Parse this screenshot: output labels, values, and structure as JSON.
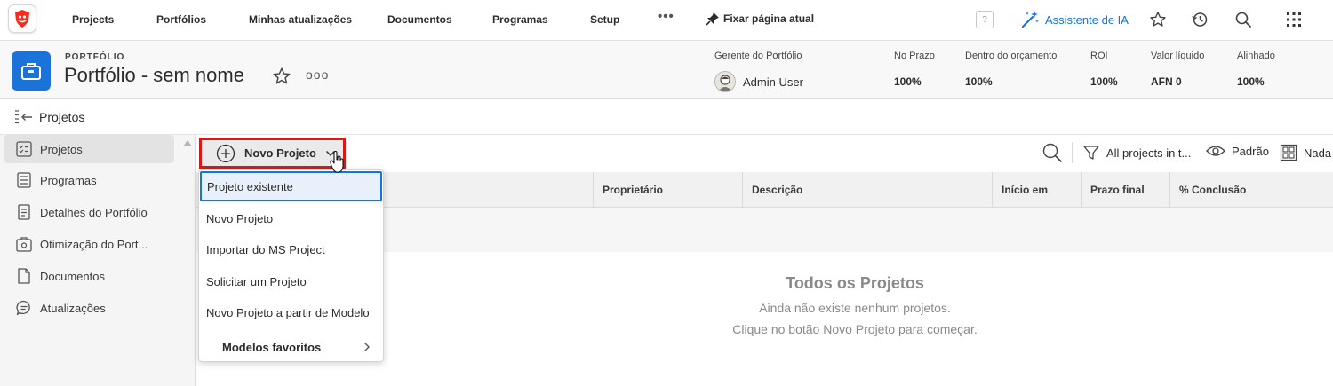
{
  "topnav": {
    "items": [
      "Projects",
      "Portfólios",
      "Minhas atualizações",
      "Documentos",
      "Programas",
      "Setup"
    ],
    "more": "•••",
    "pin_label": "Fixar página atual",
    "help": "?",
    "ai_label": "Assistente de IA",
    "icons": [
      "star-icon",
      "history-icon",
      "search-icon",
      "apps-grid-icon"
    ]
  },
  "header": {
    "eyebrow": "PORTFÓLIO",
    "title": "Portfólio - sem nome",
    "more": "ooo",
    "manager_label": "Gerente do Portfólio",
    "manager_name": "Admin User",
    "stats": [
      {
        "label": "No Prazo",
        "value": "100%"
      },
      {
        "label": "Dentro do orçamento",
        "value": "100%"
      },
      {
        "label": "ROI",
        "value": "100%"
      },
      {
        "label": "Valor líquido",
        "value": "AFN 0"
      },
      {
        "label": "Alinhado",
        "value": "100%"
      }
    ]
  },
  "section": {
    "label": "Projetos"
  },
  "sidebar": {
    "items": [
      {
        "label": "Projetos",
        "icon": "projects-icon",
        "active": true
      },
      {
        "label": "Programas",
        "icon": "programs-icon"
      },
      {
        "label": "Detalhes do Portfólio",
        "icon": "document-icon"
      },
      {
        "label": "Otimização do Port...",
        "icon": "optimization-icon"
      },
      {
        "label": "Documentos",
        "icon": "page-icon"
      },
      {
        "label": "Atualizações",
        "icon": "comment-icon"
      }
    ]
  },
  "toolbar": {
    "new_project": "Novo Projeto",
    "filter": "All projects in t...",
    "view": "Padrão",
    "grouping": "Nada"
  },
  "table": {
    "columns": [
      "Proprietário",
      "Descrição",
      "Início em",
      "Prazo final",
      "% Conclusão"
    ]
  },
  "empty": {
    "title": "Todos os Projetos",
    "line1": "Ainda não existe nenhum projetos.",
    "line2": "Clique no botão Novo Projeto para começar."
  },
  "dropdown": {
    "items": [
      "Projeto existente",
      "Novo Projeto",
      "Importar do MS Project",
      "Solicitar um Projeto",
      "Novo Projeto a partir de Modelo"
    ],
    "favorites": "Modelos favoritos"
  },
  "colors": {
    "accent": "#1473e6",
    "highlight_border": "#e01616",
    "portfolio_icon": "#1b73d9"
  }
}
